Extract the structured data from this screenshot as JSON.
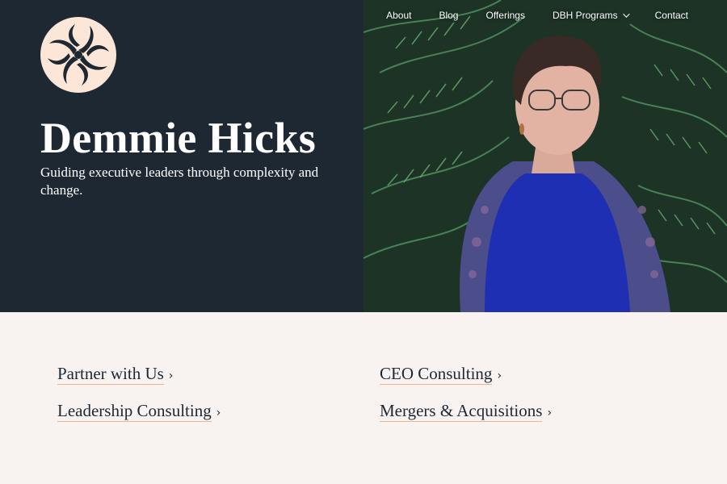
{
  "nav": {
    "items": [
      {
        "label": "About"
      },
      {
        "label": "Blog"
      },
      {
        "label": "Offerings"
      },
      {
        "label": "DBH Programs",
        "dropdown": true
      },
      {
        "label": "Contact"
      }
    ]
  },
  "hero": {
    "title": "Demmie Hicks",
    "tagline": "Guiding executive leaders through complexity and change.",
    "logo_icon": "swirl-logo-icon",
    "photo_icon": "portrait-photo"
  },
  "links": [
    {
      "label": "Partner with Us"
    },
    {
      "label": "CEO Consulting"
    },
    {
      "label": "Leadership Consulting"
    },
    {
      "label": "Mergers & Acquisitions"
    }
  ],
  "colors": {
    "hero_bg": "#1e2833",
    "page_bg": "#f8f3f1",
    "accent_underline": "#f0b38b",
    "logo_bg": "#fbe6d8",
    "text_dark": "#1e2833"
  }
}
